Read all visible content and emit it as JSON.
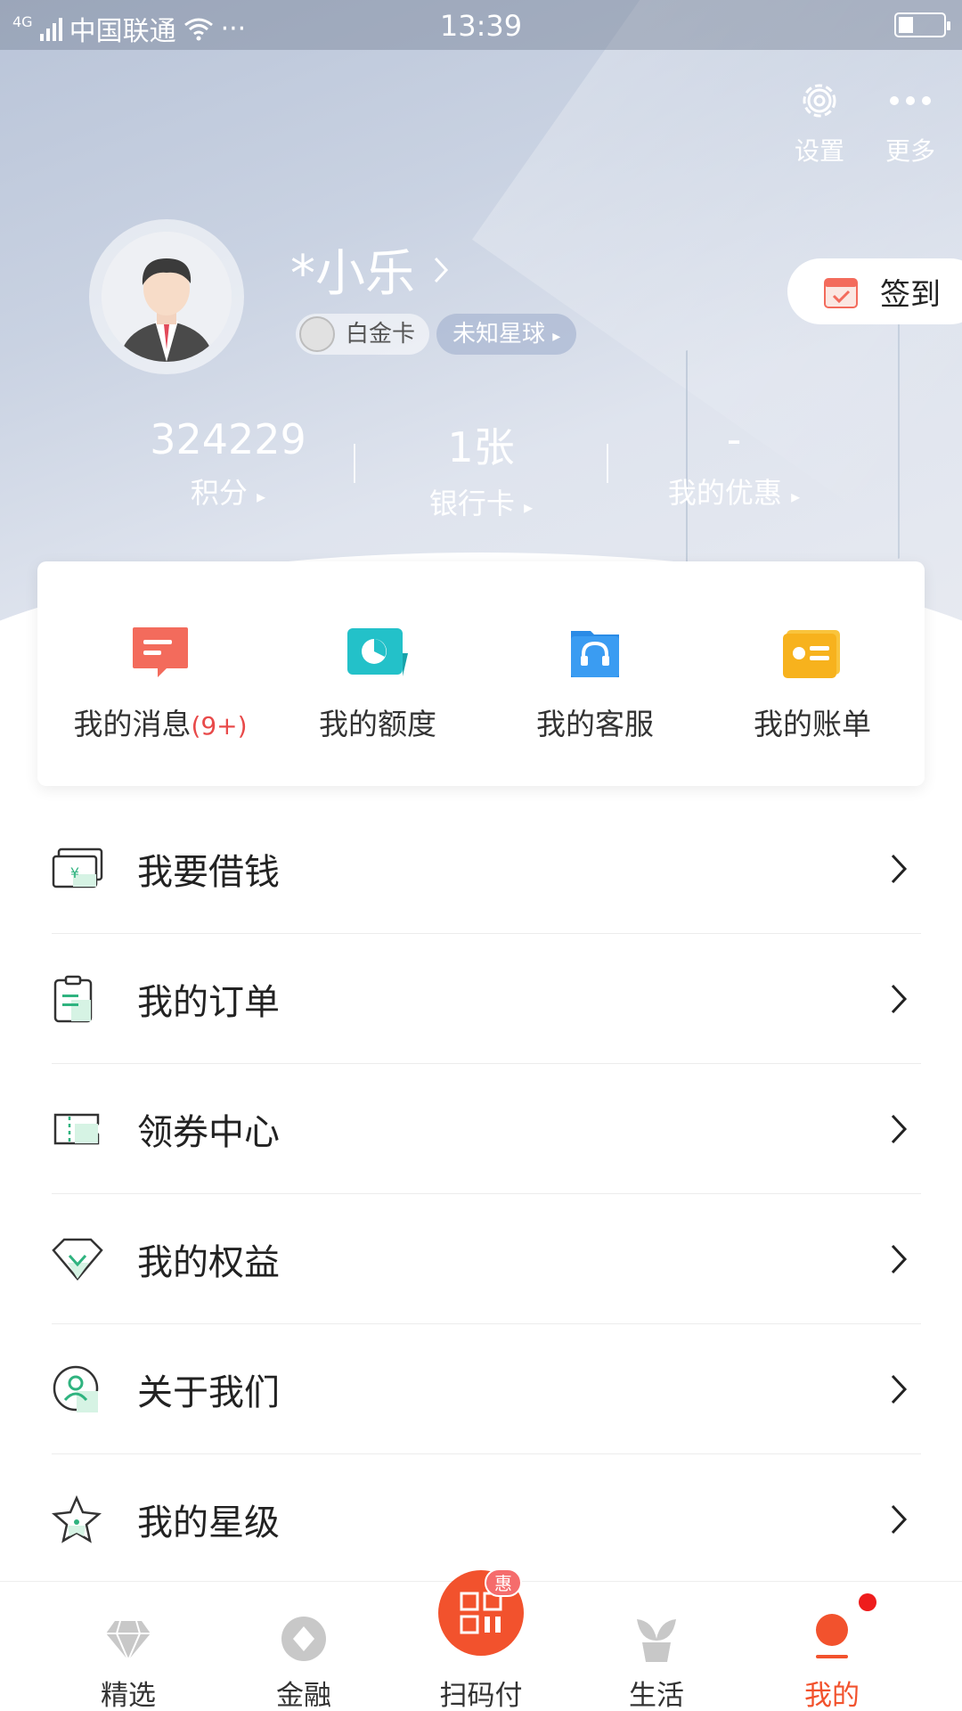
{
  "status_bar": {
    "network": "4G",
    "carrier": "中国联通",
    "extra": "···",
    "time": "13:39"
  },
  "header": {
    "settings_label": "设置",
    "more_label": "更多"
  },
  "profile": {
    "name": "*小乐",
    "card_level": "白金卡",
    "planet": "未知星球",
    "checkin_label": "签到"
  },
  "stats": [
    {
      "value": "324229",
      "label": "积分"
    },
    {
      "value": "1张",
      "label": "银行卡"
    },
    {
      "value": "-",
      "label": "我的优惠"
    }
  ],
  "quick": [
    {
      "label": "我的消息",
      "count": "(9+)",
      "icon": "message-icon",
      "color": "#f36b5c"
    },
    {
      "label": "我的额度",
      "count": "",
      "icon": "quota-icon",
      "color": "#23c1c9"
    },
    {
      "label": "我的客服",
      "count": "",
      "icon": "service-icon",
      "color": "#2a8be6"
    },
    {
      "label": "我的账单",
      "count": "",
      "icon": "bill-icon",
      "color": "#f7b21d"
    }
  ],
  "menu": [
    {
      "label": "我要借钱",
      "icon": "money-icon"
    },
    {
      "label": "我的订单",
      "icon": "order-icon"
    },
    {
      "label": "领券中心",
      "icon": "coupon-icon"
    },
    {
      "label": "我的权益",
      "icon": "diamond-icon"
    },
    {
      "label": "关于我们",
      "icon": "person-icon"
    },
    {
      "label": "我的星级",
      "icon": "star-icon"
    }
  ],
  "nav": [
    {
      "label": "精选",
      "icon": "diamond-nav-icon"
    },
    {
      "label": "金融",
      "icon": "finance-nav-icon"
    },
    {
      "label": "扫码付",
      "icon": "scan-pay-icon",
      "tag": "惠"
    },
    {
      "label": "生活",
      "icon": "plant-nav-icon"
    },
    {
      "label": "我的",
      "icon": "me-nav-icon",
      "active": true
    }
  ],
  "colors": {
    "accent": "#f2522d",
    "menu_icon": "#2fb37f",
    "active_nav": "#f2522d"
  }
}
